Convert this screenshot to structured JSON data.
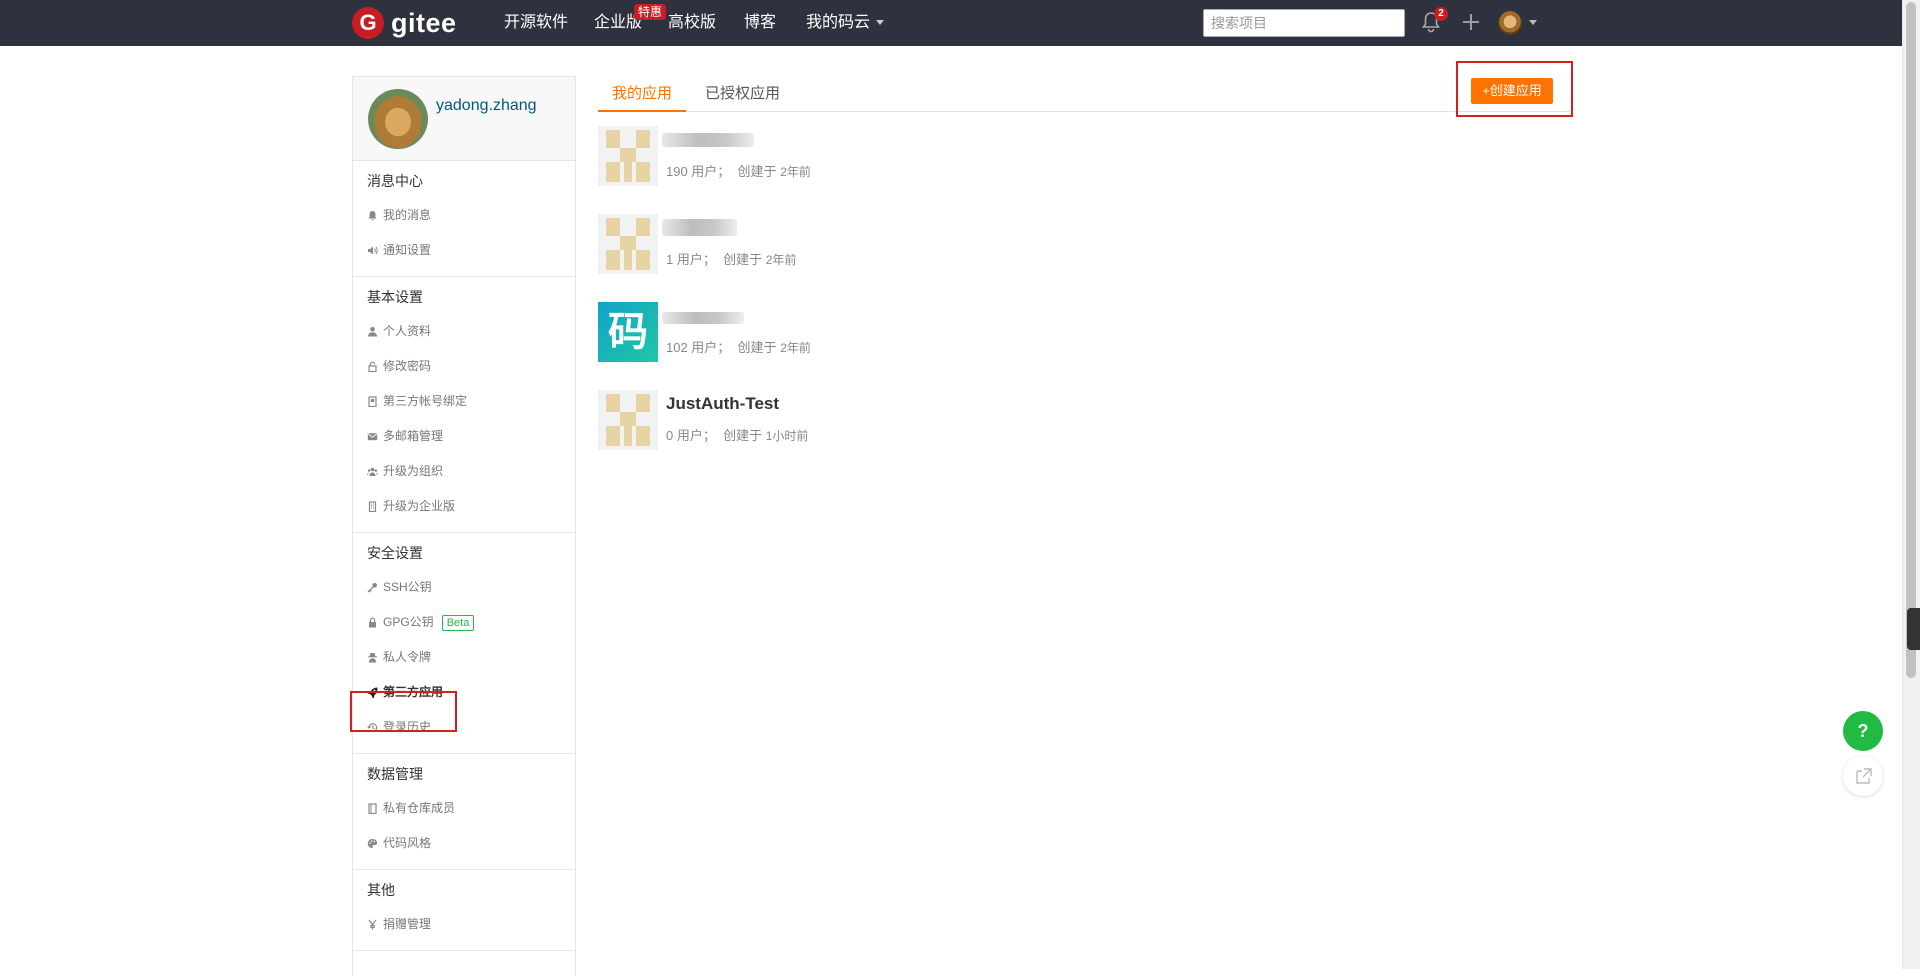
{
  "brand": {
    "logo_letter": "G",
    "name": "gitee"
  },
  "nav": {
    "items": [
      "开源软件",
      "企业版",
      "高校版",
      "博客",
      "我的码云"
    ],
    "enterprise_badge": "特惠",
    "search_placeholder": "搜索项目",
    "notification_count": "2"
  },
  "profile": {
    "username": "yadong.zhang"
  },
  "sidebar": {
    "groups": [
      {
        "title": "消息中心",
        "items": [
          "我的消息",
          "通知设置"
        ]
      },
      {
        "title": "基本设置",
        "items": [
          "个人资料",
          "修改密码",
          "第三方帐号绑定",
          "多邮箱管理",
          "升级为组织",
          "升级为企业版"
        ]
      },
      {
        "title": "安全设置",
        "items": [
          "SSH公钥",
          "GPG公钥",
          "私人令牌",
          "第三方应用",
          "登录历史"
        ],
        "beta_label": "Beta",
        "active_item": "第三方应用"
      },
      {
        "title": "数据管理",
        "items": [
          "私有仓库成员",
          "代码风格"
        ]
      },
      {
        "title": "其他",
        "items": [
          "捐赠管理"
        ]
      }
    ]
  },
  "tabs": [
    "我的应用",
    "已授权应用"
  ],
  "create_button": "+创建应用",
  "apps": [
    {
      "name": "",
      "users": "190 用户；",
      "created_label": "创建于",
      "created_ago": "2年前"
    },
    {
      "name": "",
      "users": "1 用户；",
      "created_label": "创建于",
      "created_ago": "2年前"
    },
    {
      "name": "",
      "users": "102 用户；",
      "created_label": "创建于",
      "created_ago": "2年前",
      "logo_glyph": "码"
    },
    {
      "name": "JustAuth-Test",
      "users": "0 用户；",
      "created_label": "创建于",
      "created_ago": "1小时前"
    }
  ],
  "help": {
    "label": "?"
  },
  "colors": {
    "navbar": "#2e323e",
    "accent": "#fe7300",
    "brand_red": "#c71d23",
    "link": "#005980",
    "highlight": "#d42020"
  }
}
